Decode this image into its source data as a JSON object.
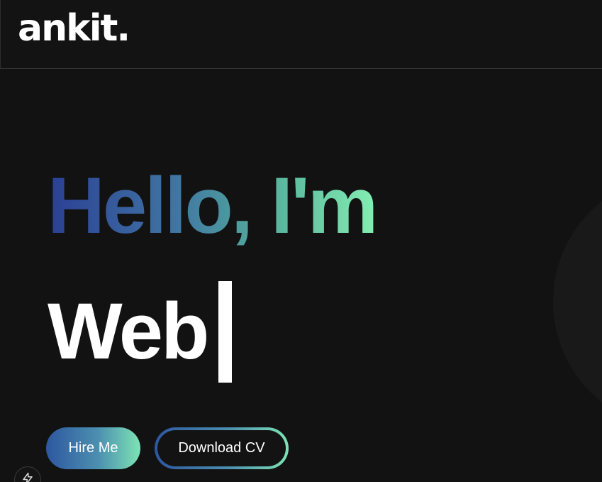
{
  "navbar": {
    "logo": "ankit."
  },
  "hero": {
    "greeting": "Hello, I'm",
    "typed_role": "Web"
  },
  "actions": {
    "hire_label": "Hire Me",
    "download_label": "Download CV"
  },
  "floating": {
    "icon": "lightning-bolt-icon"
  },
  "colors": {
    "background": "#121212",
    "gradient_start": "#2b3f94",
    "gradient_end": "#84eeb2",
    "text": "#ffffff"
  }
}
